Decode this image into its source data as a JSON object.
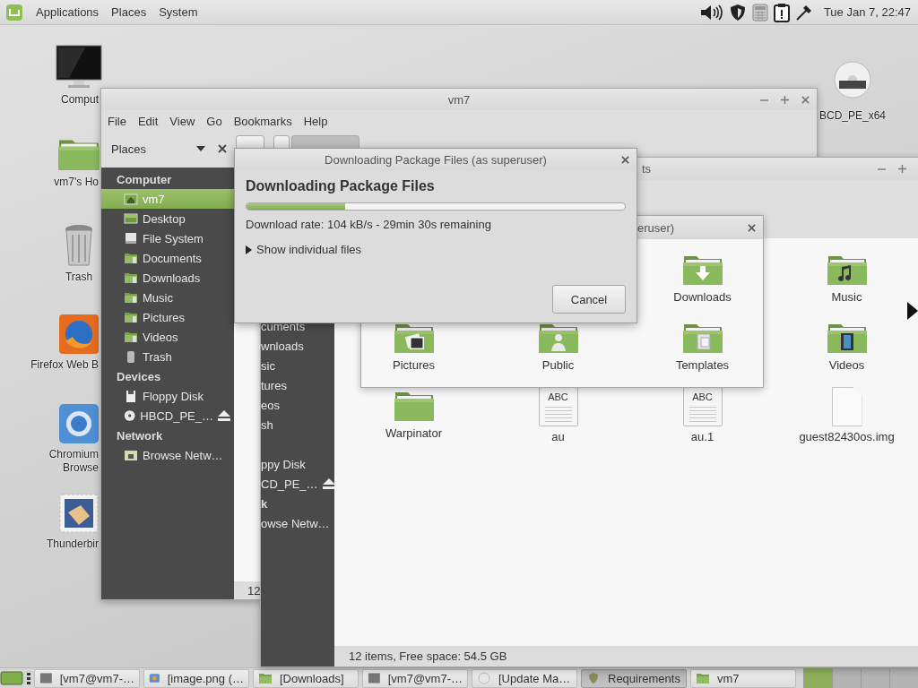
{
  "top_panel": {
    "menus": [
      "Applications",
      "Places",
      "System"
    ],
    "clock": "Tue Jan 7, 22:47"
  },
  "desktop_icons": [
    {
      "kind": "computer",
      "lines": [
        "Comput"
      ],
      "cut": true
    },
    {
      "kind": "home",
      "lines": [
        "vm7's Ho"
      ],
      "cut": true
    },
    {
      "kind": "trash",
      "lines": [
        "Trash"
      ],
      "cut": false
    },
    {
      "kind": "firefox",
      "lines": [
        "Firefox Web B"
      ],
      "cut": true
    },
    {
      "kind": "chromium",
      "lines": [
        "Chromium",
        "Browse"
      ],
      "cut": true
    },
    {
      "kind": "thunderbird",
      "lines": [
        "Thunderbir"
      ],
      "cut": true
    }
  ],
  "drive_icon": {
    "label": "BCD_PE_x64"
  },
  "file_manager": {
    "title": "vm7",
    "menu": [
      "File",
      "Edit",
      "View",
      "Go",
      "Bookmarks",
      "Help"
    ],
    "places": "Places",
    "sidebar": [
      {
        "header": "Computer",
        "items": [
          {
            "kind": "home",
            "label": "vm7",
            "selected": true
          },
          {
            "kind": "desktop",
            "label": "Desktop",
            "selected": false
          },
          {
            "kind": "drive",
            "label": "File System",
            "selected": false
          },
          {
            "kind": "folder",
            "label": "Documents",
            "selected": false
          },
          {
            "kind": "folder",
            "label": "Downloads",
            "selected": false
          },
          {
            "kind": "folder",
            "label": "Music",
            "selected": false
          },
          {
            "kind": "folder",
            "label": "Pictures",
            "selected": false
          },
          {
            "kind": "folder",
            "label": "Videos",
            "selected": false
          },
          {
            "kind": "trash",
            "label": "Trash",
            "selected": false
          }
        ]
      },
      {
        "header": "Devices",
        "items": [
          {
            "kind": "floppy",
            "label": "Floppy Disk",
            "selected": false
          },
          {
            "kind": "disc",
            "label": "HBCD_PE_…",
            "selected": false
          }
        ]
      },
      {
        "header": "Network",
        "items": [
          {
            "kind": "network",
            "label": "Browse Netw…",
            "selected": false
          }
        ]
      }
    ],
    "status": "12"
  },
  "file_manager_2": {
    "title": "ts",
    "sidebar": [
      {
        "items": [
          {
            "kind": "folder",
            "label": "cuments",
            "selected": false
          },
          {
            "kind": "folder",
            "label": "wnloads",
            "selected": false
          },
          {
            "kind": "folder",
            "label": "sic",
            "selected": false
          },
          {
            "kind": "folder",
            "label": "tures",
            "selected": false
          },
          {
            "kind": "folder",
            "label": "eos",
            "selected": false
          },
          {
            "kind": "trash",
            "label": "sh",
            "selected": false
          }
        ]
      },
      {
        "items": [
          {
            "kind": "floppy",
            "label": "ppy Disk",
            "selected": false
          },
          {
            "kind": "disc",
            "label": "CD_PE_…",
            "selected": false
          }
        ]
      },
      {
        "header": "k",
        "items": [
          {
            "kind": "network",
            "label": "owse Netw…",
            "selected": false
          }
        ]
      }
    ],
    "files": [
      {
        "kind": "download",
        "label": "Downloads"
      },
      {
        "kind": "music",
        "label": "Music"
      },
      {
        "kind": "picture",
        "label": "Pictures"
      },
      {
        "kind": "person",
        "label": "Public"
      },
      {
        "kind": "template",
        "label": "Templates"
      },
      {
        "kind": "film",
        "label": "Videos"
      },
      {
        "kind": "folder",
        "label": "Warpinator"
      },
      {
        "kind": "text",
        "badge": "ABC",
        "label": "au"
      },
      {
        "kind": "text",
        "badge": "ABC",
        "label": "au.1"
      },
      {
        "kind": "blank",
        "label": "guest82430os.img"
      }
    ],
    "status": "12 items, Free space: 54.5 GB"
  },
  "partial_dialog": {
    "title": "eruser)"
  },
  "progress_dialog": {
    "title": "Downloading Package Files (as superuser)",
    "heading": "Downloading Package Files",
    "level": 0.26,
    "rate": "Download rate: 104 kB/s - 29min 30s remaining",
    "expander": {
      "label": "Show individual files",
      "expanded": false
    },
    "button": "Cancel"
  },
  "taskbar": {
    "tasks": [
      {
        "kind": "terminal",
        "label": "[vm7@vm7-…",
        "selected": false
      },
      {
        "kind": "image",
        "label": "[image.png (…",
        "selected": false
      },
      {
        "kind": "folder",
        "label": "[Downloads]",
        "selected": false
      },
      {
        "kind": "terminal",
        "label": "[vm7@vm7-…",
        "selected": false
      },
      {
        "kind": "update",
        "label": "[Update Ma…",
        "selected": false
      },
      {
        "kind": "shield",
        "label": "Requirements",
        "selected": true
      },
      {
        "kind": "folder",
        "label": "vm7",
        "selected": false
      }
    ],
    "workspaces": [
      {
        "selected": true
      },
      {
        "selected": false
      },
      {
        "selected": false
      },
      {
        "selected": false
      }
    ]
  }
}
